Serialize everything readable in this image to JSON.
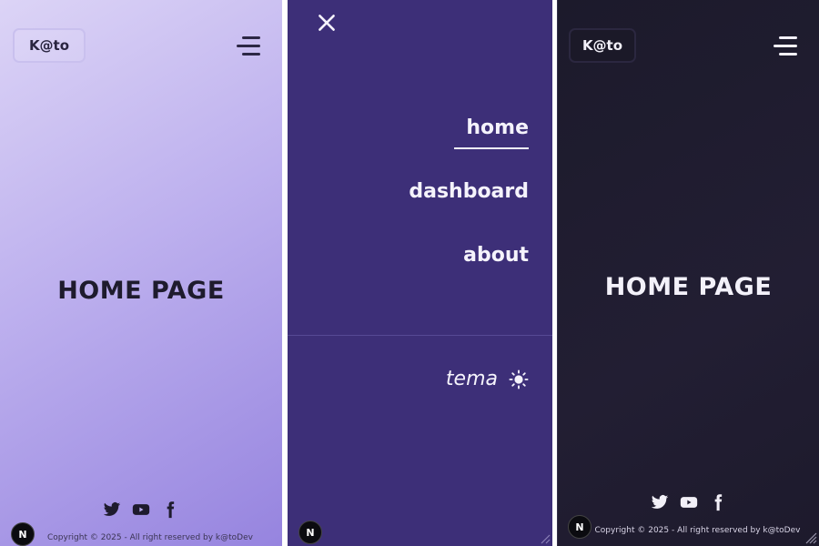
{
  "light": {
    "logo": "K@to",
    "title": "HOME PAGE",
    "copyright": "Copyright © 2025 - All right reserved by k@toDev",
    "badge": "N"
  },
  "menu": {
    "nav": [
      {
        "label": "home",
        "active": true
      },
      {
        "label": "dashboard",
        "active": false
      },
      {
        "label": "about",
        "active": false
      }
    ],
    "theme_label": "tema",
    "badge": "N"
  },
  "dark": {
    "logo": "K@to",
    "title": "HOME PAGE",
    "copyright": "Copyright © 2025 - All right reserved by k@toDev",
    "badge": "N"
  },
  "icons": {
    "menu": "hamburger-icon",
    "close": "close-icon",
    "theme": "sun-icon",
    "social": [
      "twitter-icon",
      "youtube-icon",
      "facebook-icon"
    ]
  },
  "colors": {
    "menu_bg": "#3d2f78",
    "dark_bg": "#1f1c2e",
    "light_gradient_start": "#dcd4f6",
    "light_gradient_end": "#9684df"
  }
}
